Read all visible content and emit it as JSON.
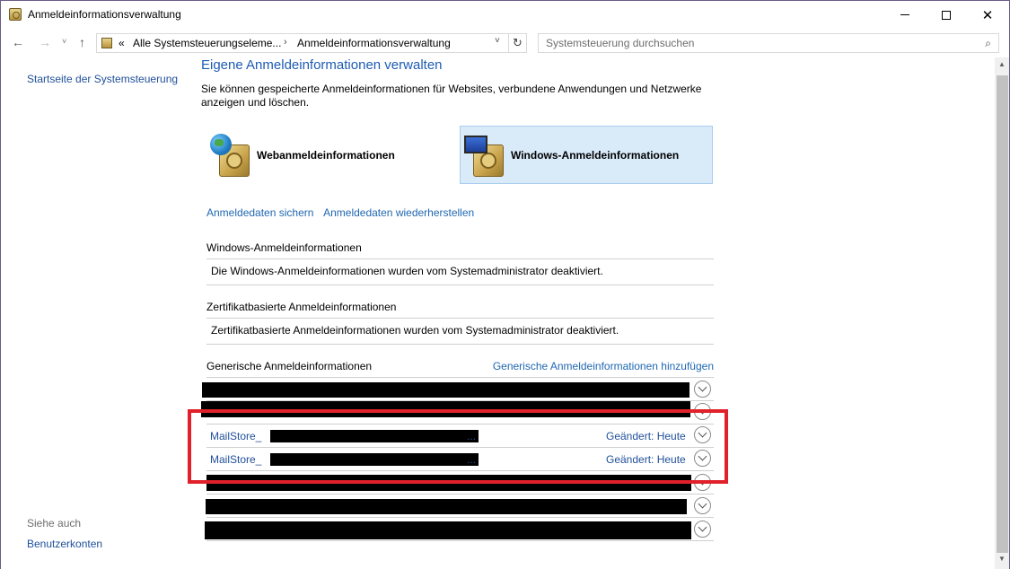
{
  "window": {
    "title": "Anmeldeinformationsverwaltung",
    "minimize_glyph": "",
    "close_glyph": "✕"
  },
  "nav": {
    "back_glyph": "←",
    "forward_glyph": "→",
    "recent_glyph": "˅",
    "up_glyph": "↑",
    "crumb_prefix": "«",
    "crumb_1": "Alle Systemsteuerungseleme...",
    "crumb_sep": "›",
    "crumb_2": "Anmeldeinformationsverwaltung",
    "dropdown_glyph": "˅",
    "refresh_glyph": "↻",
    "search_placeholder": "Systemsteuerung durchsuchen",
    "search_glyph": "⌕"
  },
  "left": {
    "home_link": "Startseite der Systemsteuerung",
    "see_also": "Siehe auch",
    "user_accounts": "Benutzerkonten"
  },
  "main": {
    "title": "Eigene Anmeldeinformationen verwalten",
    "intro": "Sie können gespeicherte Anmeldeinformationen für Websites, verbundene Anwendungen und Netzwerke anzeigen und löschen.",
    "tiles": [
      {
        "label": "Webanmeldeinformationen",
        "icon": "web-credentials-icon",
        "selected": false
      },
      {
        "label": "Windows-Anmeldeinformationen",
        "icon": "windows-credentials-icon",
        "selected": true
      }
    ],
    "backup_link": "Anmeldedaten sichern",
    "restore_link": "Anmeldedaten wiederherstellen",
    "windows_section": {
      "heading": "Windows-Anmeldeinformationen",
      "message": "Die Windows-Anmeldeinformationen wurden vom Systemadministrator deaktiviert."
    },
    "certificate_section": {
      "heading": "Zertifikatbasierte Anmeldeinformationen",
      "message": "Zertifikatbasierte Anmeldeinformationen wurden vom Systemadministrator deaktiviert."
    },
    "generic_section": {
      "heading": "Generische Anmeldeinformationen",
      "add_link": "Generische Anmeldeinformationen hinzufügen",
      "entries": [
        {
          "name": "",
          "changed": ""
        },
        {
          "name": "",
          "changed": ""
        },
        {
          "name": "MailStore_",
          "ellipsis": "...",
          "changed": "Geändert:  Heute"
        },
        {
          "name": "MailStore_",
          "ellipsis": "...",
          "changed": "Geändert:  Heute"
        },
        {
          "name": "",
          "changed": ""
        },
        {
          "name": "",
          "changed": ""
        },
        {
          "name": "",
          "changed": ""
        }
      ]
    }
  },
  "colors": {
    "highlight": "#e0202a",
    "link": "#1f67b1",
    "title": "#1e5cb3",
    "selected_tile": "#d9eaf9"
  }
}
